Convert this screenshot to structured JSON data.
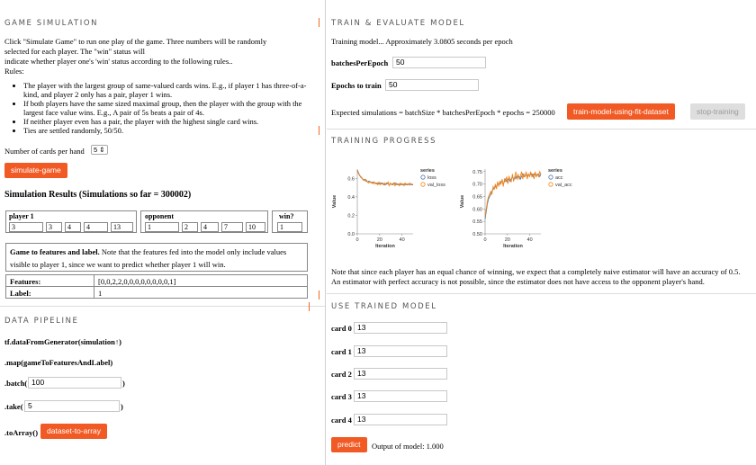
{
  "game_simulation": {
    "title": "GAME SIMULATION",
    "description_line1": "Click \"Simulate Game\" to run one play of the game. Three numbers will be randomly",
    "description_line2": "selected for each player. The \"win\" status will",
    "description_line3": "indicate whether player one's 'win' status according to the following rules..",
    "rules_label": "Rules:",
    "rules": [
      "The player with the largest group of same-valued cards wins. E.g., if player 1 has three-of-a-kind, and player 2 only has a pair, player 1 wins.",
      "If both players have the same sized maximal group, then the player with the group with the largest face value wins. E.g., A pair of 5s beats a pair of 4s.",
      "If neither player even has a pair, the player with the highest single card wins.",
      "Ties are settled randomly, 50/50."
    ],
    "num_cards_label": "Number of cards per hand",
    "num_cards_value": "5",
    "simulate_button": "simulate-game",
    "results_title": "Simulation Results (Simulations so far = 300002)",
    "player1_label": "player 1",
    "opponent_label": "opponent",
    "win_label": "win?",
    "player1_cards": [
      "3",
      "3",
      "4",
      "4",
      "13"
    ],
    "opponent_cards": [
      "1",
      "2",
      "4",
      "7",
      "10"
    ],
    "win_value": "1",
    "features_note_bold": "Game to features and label.",
    "features_note_rest_line1": " Note that the features fed into the model only include values",
    "features_note_line2": "visible to player 1, since we want to  predict whether player 1 will win.",
    "features_label": "Features:",
    "features_value": "[0,0,2,2,0,0,0,0,0,0,0,0,1]",
    "label_label": "Label:",
    "label_value": "1"
  },
  "data_pipeline": {
    "title": "DATA PIPELINE",
    "line1": "tf.dataFromGenerator(simulation↑)",
    "line2": ".map(gameToFeaturesAndLabel)",
    "batch_label": ".batch(",
    "batch_value": "100",
    "close_paren": ")",
    "take_label": ".take(",
    "take_value": "5",
    "to_array_label": ".toArray()",
    "to_array_button": "dataset-to-array"
  },
  "train": {
    "title": "TRAIN & EVALUATE MODEL",
    "status": "Training model... Approximately 3.0805 seconds per epoch",
    "batches_label": "batchesPerEpoch",
    "batches_value": "50",
    "epochs_label": "Epochs to train",
    "epochs_value": "50",
    "expected_text": "Expected simulations = batchSize * batchesPerEpoch * epochs = 250000",
    "train_button": "train-model-using-fit-dataset",
    "stop_button": "stop-training"
  },
  "progress": {
    "title": "TRAINING PROGRESS",
    "note_line1": "Note that since each player has an equal chance of winning, we expect that a completely naive estimator will have an accuracy of 0.5.",
    "note_line2": "An estimator with perfect accuracy is not possible, since the estimator does not have access to the opponent player's hand."
  },
  "chart_data": [
    {
      "type": "line",
      "xlabel": "Iteration",
      "ylabel": "Value",
      "legend_title": "series",
      "legend_placement": "right",
      "ylim": [
        0,
        0.7
      ],
      "xlim": [
        0,
        50
      ],
      "yticks": [
        "0.0",
        "0.2",
        "0.4",
        "0.6"
      ],
      "xticks": [
        "0",
        "20",
        "40"
      ],
      "series": [
        {
          "name": "loss",
          "color": "#4c78a8",
          "values": [
            0.69,
            0.66,
            0.63,
            0.62,
            0.6,
            0.59,
            0.58,
            0.59,
            0.57,
            0.56,
            0.57,
            0.56,
            0.56,
            0.55,
            0.56,
            0.55,
            0.55,
            0.54,
            0.55,
            0.54,
            0.55,
            0.54,
            0.55,
            0.54,
            0.53,
            0.54,
            0.55,
            0.54,
            0.53,
            0.54,
            0.54,
            0.53,
            0.54,
            0.55,
            0.53,
            0.54,
            0.53,
            0.54,
            0.53,
            0.54,
            0.53,
            0.54,
            0.53,
            0.54,
            0.53,
            0.54,
            0.53,
            0.54,
            0.53,
            0.53
          ]
        },
        {
          "name": "val_loss",
          "color": "#f58518",
          "values": [
            0.68,
            0.65,
            0.64,
            0.61,
            0.61,
            0.58,
            0.59,
            0.57,
            0.58,
            0.56,
            0.55,
            0.57,
            0.55,
            0.56,
            0.54,
            0.56,
            0.54,
            0.55,
            0.53,
            0.56,
            0.53,
            0.55,
            0.54,
            0.53,
            0.55,
            0.53,
            0.54,
            0.56,
            0.52,
            0.55,
            0.53,
            0.54,
            0.55,
            0.52,
            0.55,
            0.53,
            0.54,
            0.52,
            0.55,
            0.53,
            0.54,
            0.52,
            0.55,
            0.53,
            0.54,
            0.53,
            0.55,
            0.53,
            0.54,
            0.53
          ]
        }
      ]
    },
    {
      "type": "line",
      "xlabel": "Iteration",
      "ylabel": "Value",
      "legend_title": "series",
      "legend_placement": "right",
      "ylim": [
        0.5,
        0.76
      ],
      "xlim": [
        0,
        50
      ],
      "yticks": [
        "0.50",
        "0.55",
        "0.60",
        "0.65",
        "0.70",
        "0.75"
      ],
      "xticks": [
        "0",
        "20",
        "40"
      ],
      "series": [
        {
          "name": "acc",
          "color": "#4c78a8",
          "values": [
            0.56,
            0.59,
            0.62,
            0.64,
            0.65,
            0.66,
            0.67,
            0.68,
            0.68,
            0.69,
            0.69,
            0.7,
            0.7,
            0.7,
            0.71,
            0.71,
            0.7,
            0.71,
            0.72,
            0.71,
            0.72,
            0.72,
            0.71,
            0.72,
            0.73,
            0.72,
            0.72,
            0.73,
            0.72,
            0.73,
            0.73,
            0.72,
            0.73,
            0.74,
            0.73,
            0.73,
            0.74,
            0.73,
            0.74,
            0.73,
            0.74,
            0.74,
            0.73,
            0.74,
            0.74,
            0.73,
            0.74,
            0.74,
            0.73,
            0.74
          ]
        },
        {
          "name": "val_acc",
          "color": "#f58518",
          "values": [
            0.57,
            0.6,
            0.63,
            0.65,
            0.66,
            0.67,
            0.66,
            0.69,
            0.68,
            0.7,
            0.68,
            0.71,
            0.69,
            0.71,
            0.7,
            0.72,
            0.69,
            0.72,
            0.71,
            0.73,
            0.7,
            0.73,
            0.72,
            0.71,
            0.74,
            0.71,
            0.73,
            0.75,
            0.72,
            0.74,
            0.72,
            0.73,
            0.75,
            0.72,
            0.74,
            0.73,
            0.75,
            0.72,
            0.74,
            0.73,
            0.75,
            0.73,
            0.74,
            0.72,
            0.75,
            0.73,
            0.74,
            0.73,
            0.75,
            0.74
          ]
        }
      ]
    }
  ],
  "use_model": {
    "title": "USE TRAINED MODEL",
    "cards": [
      {
        "label": "card 0",
        "value": "13"
      },
      {
        "label": "card 1",
        "value": "13"
      },
      {
        "label": "card 2",
        "value": "13"
      },
      {
        "label": "card 3",
        "value": "13"
      },
      {
        "label": "card 4",
        "value": "13"
      }
    ],
    "predict_button": "predict",
    "output_text": "Output of model: 1.000"
  }
}
